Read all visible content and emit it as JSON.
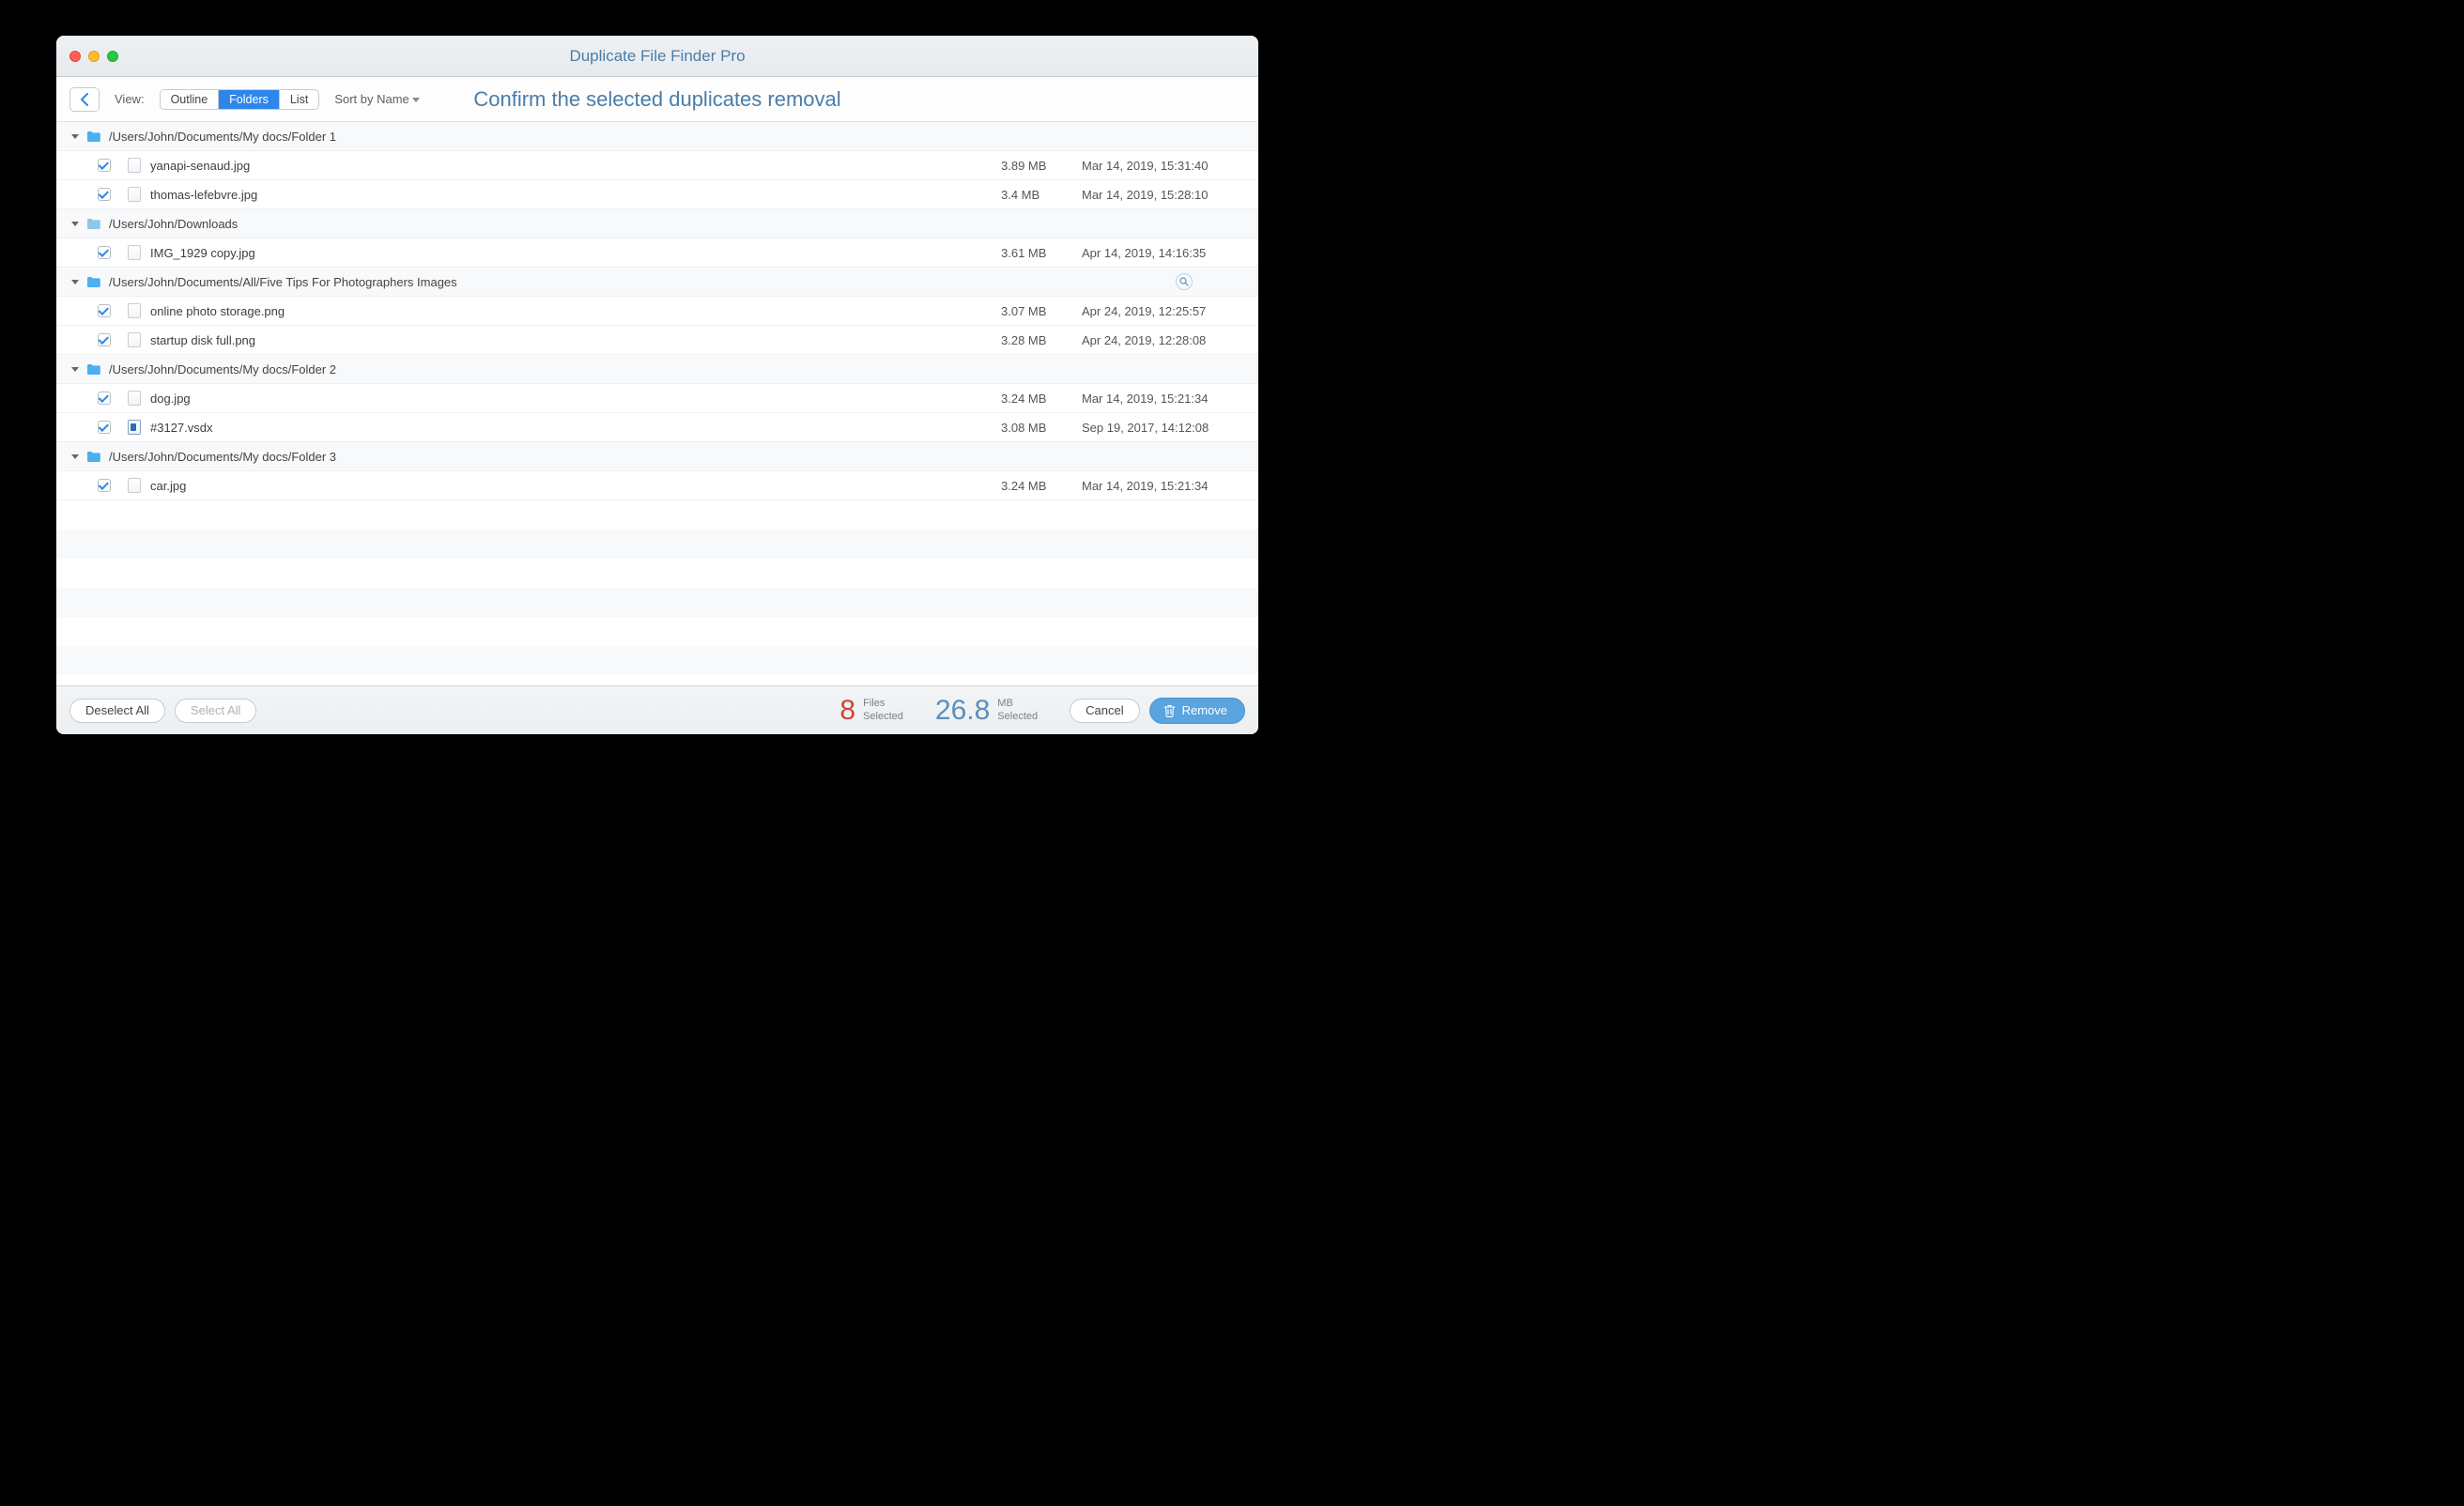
{
  "window": {
    "title": "Duplicate File Finder Pro"
  },
  "toolbar": {
    "view_label": "View:",
    "tabs": {
      "outline": "Outline",
      "folders": "Folders",
      "list": "List"
    },
    "sort_label": "Sort by Name",
    "headline": "Confirm the selected duplicates removal"
  },
  "groups": [
    {
      "path": "/Users/John/Documents/My docs/Folder 1",
      "iconColor": "#4bb0ef",
      "files": [
        {
          "name": "yanapi-senaud.jpg",
          "size": "3.89 MB",
          "date": "Mar 14, 2019, 15:31:40",
          "checked": true,
          "type": "img"
        },
        {
          "name": "thomas-lefebvre.jpg",
          "size": "3.4 MB",
          "date": "Mar 14, 2019, 15:28:10",
          "checked": true,
          "type": "img"
        }
      ]
    },
    {
      "path": "/Users/John/Downloads",
      "iconColor": "#8cc7e8",
      "files": [
        {
          "name": "IMG_1929 copy.jpg",
          "size": "3.61 MB",
          "date": "Apr 14, 2019, 14:16:35",
          "checked": true,
          "type": "img"
        }
      ]
    },
    {
      "path": "/Users/John/Documents/All/Five Tips For Photographers Images",
      "iconColor": "#4bb0ef",
      "showMagnify": true,
      "files": [
        {
          "name": "online photo storage.png",
          "size": "3.07 MB",
          "date": "Apr 24, 2019, 12:25:57",
          "checked": true,
          "type": "img"
        },
        {
          "name": "startup disk full.png",
          "size": "3.28 MB",
          "date": "Apr 24, 2019, 12:28:08",
          "checked": true,
          "type": "img"
        }
      ]
    },
    {
      "path": "/Users/John/Documents/My docs/Folder 2",
      "iconColor": "#4bb0ef",
      "files": [
        {
          "name": "dog.jpg",
          "size": "3.24 MB",
          "date": "Mar 14, 2019, 15:21:34",
          "checked": true,
          "type": "img"
        },
        {
          "name": "#3127.vsdx",
          "size": "3.08 MB",
          "date": "Sep 19, 2017, 14:12:08",
          "checked": true,
          "type": "vsdx"
        }
      ]
    },
    {
      "path": "/Users/John/Documents/My docs/Folder 3",
      "iconColor": "#4bb0ef",
      "files": [
        {
          "name": "car.jpg",
          "size": "3.24 MB",
          "date": "Mar 14, 2019, 15:21:34",
          "checked": true,
          "type": "img"
        }
      ]
    }
  ],
  "footer": {
    "deselect": "Deselect All",
    "select": "Select All",
    "files_count": "8",
    "files_label_top": "Files",
    "files_label_bot": "Selected",
    "size_value": "26.8",
    "size_label_top": "MB",
    "size_label_bot": "Selected",
    "cancel": "Cancel",
    "remove": "Remove"
  }
}
